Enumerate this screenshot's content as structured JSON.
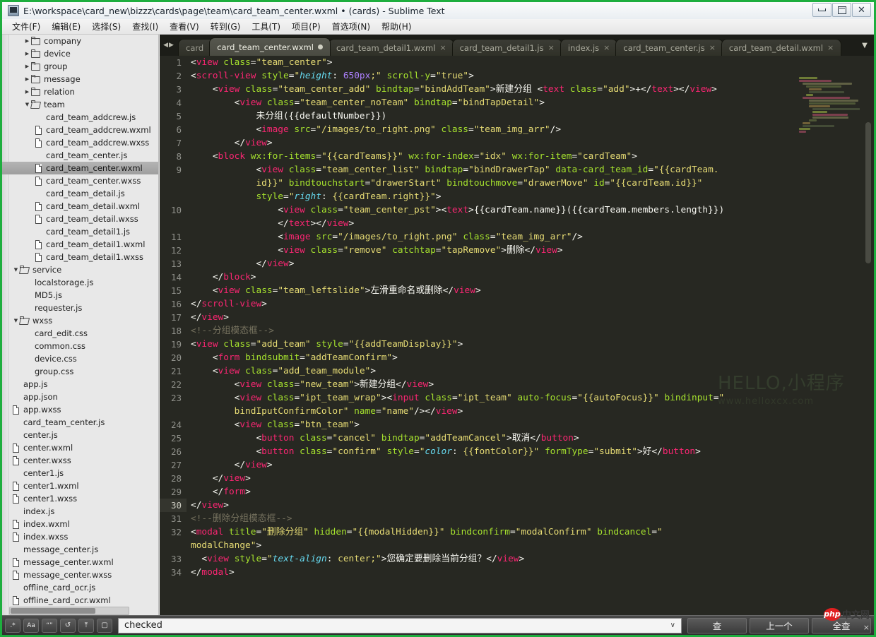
{
  "window": {
    "title": "E:\\workspace\\card_new\\bizzz\\cards\\page\\team\\card_team_center.wxml • (cards) - Sublime Text",
    "minimize_label": "—",
    "maximize_label": "□",
    "close_label": "✕",
    "accent_border": "#1eae3e"
  },
  "menu": [
    {
      "label": "文件(F)"
    },
    {
      "label": "编辑(E)"
    },
    {
      "label": "选择(S)"
    },
    {
      "label": "查找(I)"
    },
    {
      "label": "查看(V)"
    },
    {
      "label": "转到(G)"
    },
    {
      "label": "工具(T)"
    },
    {
      "label": "项目(P)"
    },
    {
      "label": "首选项(N)"
    },
    {
      "label": "帮助(H)"
    }
  ],
  "sidebar": {
    "items": [
      {
        "label": "company",
        "depth": 1,
        "kind": "folder",
        "open": false
      },
      {
        "label": "device",
        "depth": 1,
        "kind": "folder",
        "open": false
      },
      {
        "label": "group",
        "depth": 1,
        "kind": "folder",
        "open": false
      },
      {
        "label": "message",
        "depth": 1,
        "kind": "folder",
        "open": false
      },
      {
        "label": "relation",
        "depth": 1,
        "kind": "folder",
        "open": false
      },
      {
        "label": "team",
        "depth": 1,
        "kind": "folder",
        "open": true
      },
      {
        "label": "card_team_addcrew.js",
        "depth": 2,
        "kind": "plain"
      },
      {
        "label": "card_team_addcrew.wxml",
        "depth": 2,
        "kind": "file"
      },
      {
        "label": "card_team_addcrew.wxss",
        "depth": 2,
        "kind": "file"
      },
      {
        "label": "card_team_center.js",
        "depth": 2,
        "kind": "plain"
      },
      {
        "label": "card_team_center.wxml",
        "depth": 2,
        "kind": "file",
        "selected": true
      },
      {
        "label": "card_team_center.wxss",
        "depth": 2,
        "kind": "file"
      },
      {
        "label": "card_team_detail.js",
        "depth": 2,
        "kind": "plain"
      },
      {
        "label": "card_team_detail.wxml",
        "depth": 2,
        "kind": "file"
      },
      {
        "label": "card_team_detail.wxss",
        "depth": 2,
        "kind": "file"
      },
      {
        "label": "card_team_detail1.js",
        "depth": 2,
        "kind": "plain"
      },
      {
        "label": "card_team_detail1.wxml",
        "depth": 2,
        "kind": "file"
      },
      {
        "label": "card_team_detail1.wxss",
        "depth": 2,
        "kind": "file"
      },
      {
        "label": "service",
        "depth": 0,
        "kind": "folder",
        "open": true
      },
      {
        "label": "localstorage.js",
        "depth": 1,
        "kind": "plain"
      },
      {
        "label": "MD5.js",
        "depth": 1,
        "kind": "plain"
      },
      {
        "label": "requester.js",
        "depth": 1,
        "kind": "plain"
      },
      {
        "label": "wxss",
        "depth": 0,
        "kind": "folder",
        "open": true
      },
      {
        "label": "card_edit.css",
        "depth": 1,
        "kind": "plain"
      },
      {
        "label": "common.css",
        "depth": 1,
        "kind": "plain"
      },
      {
        "label": "device.css",
        "depth": 1,
        "kind": "plain"
      },
      {
        "label": "group.css",
        "depth": 1,
        "kind": "plain"
      },
      {
        "label": "app.js",
        "depth": 0,
        "kind": "plain"
      },
      {
        "label": "app.json",
        "depth": 0,
        "kind": "plain"
      },
      {
        "label": "app.wxss",
        "depth": 0,
        "kind": "file"
      },
      {
        "label": "card_team_center.js",
        "depth": 0,
        "kind": "plain"
      },
      {
        "label": "center.js",
        "depth": 0,
        "kind": "plain"
      },
      {
        "label": "center.wxml",
        "depth": 0,
        "kind": "file"
      },
      {
        "label": "center.wxss",
        "depth": 0,
        "kind": "file"
      },
      {
        "label": "center1.js",
        "depth": 0,
        "kind": "plain"
      },
      {
        "label": "center1.wxml",
        "depth": 0,
        "kind": "file"
      },
      {
        "label": "center1.wxss",
        "depth": 0,
        "kind": "file"
      },
      {
        "label": "index.js",
        "depth": 0,
        "kind": "plain"
      },
      {
        "label": "index.wxml",
        "depth": 0,
        "kind": "file"
      },
      {
        "label": "index.wxss",
        "depth": 0,
        "kind": "file"
      },
      {
        "label": "message_center.js",
        "depth": 0,
        "kind": "plain"
      },
      {
        "label": "message_center.wxml",
        "depth": 0,
        "kind": "file"
      },
      {
        "label": "message_center.wxss",
        "depth": 0,
        "kind": "file"
      },
      {
        "label": "offline_card_ocr.js",
        "depth": 0,
        "kind": "plain"
      },
      {
        "label": "offline_card_ocr.wxml",
        "depth": 0,
        "kind": "file"
      }
    ]
  },
  "tabs": {
    "nav_prev": "◀",
    "nav_next": "▶",
    "dropdown": "▼",
    "items": [
      {
        "label": "card",
        "active": false,
        "modified": false,
        "partial": true,
        "close": ""
      },
      {
        "label": "card_team_center.wxml",
        "active": true,
        "modified": true,
        "partial": false,
        "close": ""
      },
      {
        "label": "card_team_detail1.wxml",
        "active": false,
        "modified": false,
        "partial": false,
        "close": "×"
      },
      {
        "label": "card_team_detail1.js",
        "active": false,
        "modified": false,
        "partial": false,
        "close": "×"
      },
      {
        "label": "index.js",
        "active": false,
        "modified": false,
        "partial": false,
        "close": "×"
      },
      {
        "label": "card_team_center.js",
        "active": false,
        "modified": false,
        "partial": false,
        "close": "×"
      },
      {
        "label": "card_team_detail.wxml",
        "active": false,
        "modified": false,
        "partial": false,
        "close": "×"
      }
    ]
  },
  "editor": {
    "current_line": 30,
    "line_numbers": [
      1,
      2,
      3,
      4,
      5,
      6,
      7,
      8,
      9,
      null,
      null,
      10,
      null,
      11,
      12,
      13,
      14,
      15,
      16,
      17,
      18,
      19,
      20,
      21,
      22,
      23,
      null,
      24,
      25,
      26,
      27,
      28,
      29,
      30,
      31,
      32,
      null,
      33,
      34
    ],
    "lines": [
      {
        "n": 1,
        "html": "<span class='pun'>&lt;</span><span class='tagname'>view</span> <span class='attr'>class</span><span class='pun'>=</span><span class='str'>\"team_center\"</span><span class='pun'>&gt;</span>"
      },
      {
        "n": 2,
        "html": "<span class='pun'>&lt;</span><span class='tagname'>scroll-view</span> <span class='attr'>style</span><span class='pun'>=</span><span class='str'>\"</span><span class='prop'>height</span><span class='pun'>: </span><span class='num'>650px</span><span class='str'>;\"</span> <span class='attr'>scroll-y</span><span class='pun'>=</span><span class='str'>\"true\"</span><span class='pun'>&gt;</span>"
      },
      {
        "n": 3,
        "html": "    <span class='pun'>&lt;</span><span class='tagname'>view</span> <span class='attr'>class</span><span class='pun'>=</span><span class='str'>\"team_center_add\"</span> <span class='attr'>bindtap</span><span class='pun'>=</span><span class='str'>\"bindAddTeam\"</span><span class='pun'>&gt;</span><span class='txt'>新建分组 </span><span class='pun'>&lt;</span><span class='tagname'>text</span> <span class='attr'>class</span><span class='pun'>=</span><span class='str'>\"add\"</span><span class='pun'>&gt;+&lt;/</span><span class='tagname'>text</span><span class='pun'>&gt;&lt;/</span><span class='tagname'>view</span><span class='pun'>&gt;</span>"
      },
      {
        "n": 4,
        "html": "        <span class='pun'>&lt;</span><span class='tagname'>view</span> <span class='attr'>class</span><span class='pun'>=</span><span class='str'>\"team_center_noTeam\"</span> <span class='attr'>bindtap</span><span class='pun'>=</span><span class='str'>\"bindTapDetail\"</span><span class='pun'>&gt;</span>"
      },
      {
        "n": 5,
        "html": "            <span class='txt'>未分组({{defaultNumber}})</span>"
      },
      {
        "n": 6,
        "html": "            <span class='pun'>&lt;</span><span class='tagname'>image</span> <span class='attr'>src</span><span class='pun'>=</span><span class='str'>\"/images/to_right.png\"</span> <span class='attr'>class</span><span class='pun'>=</span><span class='str'>\"team_img_arr\"</span><span class='pun'>/&gt;</span>"
      },
      {
        "n": 7,
        "html": "        <span class='pun'>&lt;/</span><span class='tagname'>view</span><span class='pun'>&gt;</span>"
      },
      {
        "n": 8,
        "html": "    <span class='pun'>&lt;</span><span class='tagname'>block</span> <span class='attr'>wx:for-items</span><span class='pun'>=</span><span class='str'>\"{{cardTeams}}\"</span> <span class='attr'>wx:for-index</span><span class='pun'>=</span><span class='str'>\"idx\"</span> <span class='attr'>wx:for-item</span><span class='pun'>=</span><span class='str'>\"cardTeam\"</span><span class='pun'>&gt;</span>"
      },
      {
        "n": 9,
        "html": "            <span class='pun'>&lt;</span><span class='tagname'>view</span> <span class='attr'>class</span><span class='pun'>=</span><span class='str'>\"team_center_list\"</span> <span class='attr'>bindtap</span><span class='pun'>=</span><span class='str'>\"bindDrawerTap\"</span> <span class='attr'>data-card_team_id</span><span class='pun'>=</span><span class='str'>\"{{cardTeam.</span>"
      },
      {
        "n": null,
        "html": "            <span class='str'>id}}\"</span> <span class='attr'>bindtouchstart</span><span class='pun'>=</span><span class='str'>\"drawerStart\"</span> <span class='attr'>bindtouchmove</span><span class='pun'>=</span><span class='str'>\"drawerMove\"</span> <span class='attr'>id</span><span class='pun'>=</span><span class='str'>\"{{cardTeam.id}}\"</span>"
      },
      {
        "n": null,
        "html": "            <span class='attr'>style</span><span class='pun'>=</span><span class='str'>\"</span><span class='prop'>right</span><span class='pun'>: </span><span class='str'>{{cardTeam.right}}\"</span><span class='pun'>&gt;</span>"
      },
      {
        "n": 10,
        "html": "                <span class='pun'>&lt;</span><span class='tagname'>view</span> <span class='attr'>class</span><span class='pun'>=</span><span class='str'>\"team_center_pst\"</span><span class='pun'>&gt;&lt;</span><span class='tagname'>text</span><span class='pun'>&gt;</span><span class='txt'>{{cardTeam.name}}({{cardTeam.members.length}})</span>"
      },
      {
        "n": null,
        "html": "                <span class='pun'>&lt;/</span><span class='tagname'>text</span><span class='pun'>&gt;&lt;/</span><span class='tagname'>view</span><span class='pun'>&gt;</span>"
      },
      {
        "n": 11,
        "html": "                <span class='pun'>&lt;</span><span class='tagname'>image</span> <span class='attr'>src</span><span class='pun'>=</span><span class='str'>\"/images/to_right.png\"</span> <span class='attr'>class</span><span class='pun'>=</span><span class='str'>\"team_img_arr\"</span><span class='pun'>/&gt;</span>"
      },
      {
        "n": 12,
        "html": "                <span class='pun'>&lt;</span><span class='tagname'>view</span> <span class='attr'>class</span><span class='pun'>=</span><span class='str'>\"remove\"</span> <span class='attr'>catchtap</span><span class='pun'>=</span><span class='str'>\"tapRemove\"</span><span class='pun'>&gt;</span><span class='txt'>删除</span><span class='pun'>&lt;/</span><span class='tagname'>view</span><span class='pun'>&gt;</span>"
      },
      {
        "n": 13,
        "html": "            <span class='pun'>&lt;/</span><span class='tagname'>view</span><span class='pun'>&gt;</span>"
      },
      {
        "n": 14,
        "html": "    <span class='pun'>&lt;/</span><span class='tagname'>block</span><span class='pun'>&gt;</span>"
      },
      {
        "n": 15,
        "html": "    <span class='pun'>&lt;</span><span class='tagname'>view</span> <span class='attr'>class</span><span class='pun'>=</span><span class='str'>\"team_leftslide\"</span><span class='pun'>&gt;</span><span class='txt'>左滑重命名或删除</span><span class='pun'>&lt;/</span><span class='tagname'>view</span><span class='pun'>&gt;</span>"
      },
      {
        "n": 16,
        "html": "<span class='pun'>&lt;/</span><span class='tagname'>scroll-view</span><span class='pun'>&gt;</span>"
      },
      {
        "n": 17,
        "html": "<span class='pun'>&lt;/</span><span class='tagname'>view</span><span class='pun'>&gt;</span>"
      },
      {
        "n": 18,
        "html": "<span class='com'>&lt;!--分组模态框--&gt;</span>"
      },
      {
        "n": 19,
        "html": "<span class='pun'>&lt;</span><span class='tagname'>view</span> <span class='attr'>class</span><span class='pun'>=</span><span class='str'>\"add_team\"</span> <span class='attr'>style</span><span class='pun'>=</span><span class='str'>\"{{addTeamDisplay}}\"</span><span class='pun'>&gt;</span>"
      },
      {
        "n": 20,
        "html": "    <span class='pun'>&lt;</span><span class='tagname'>form</span> <span class='attr'>bindsubmit</span><span class='pun'>=</span><span class='str'>\"addTeamConfirm\"</span><span class='pun'>&gt;</span>"
      },
      {
        "n": 21,
        "html": "    <span class='pun'>&lt;</span><span class='tagname'>view</span> <span class='attr'>class</span><span class='pun'>=</span><span class='str'>\"add_team_module\"</span><span class='pun'>&gt;</span>"
      },
      {
        "n": 22,
        "html": "        <span class='pun'>&lt;</span><span class='tagname'>view</span> <span class='attr'>class</span><span class='pun'>=</span><span class='str'>\"new_team\"</span><span class='pun'>&gt;</span><span class='txt'>新建分组</span><span class='pun'>&lt;/</span><span class='tagname'>view</span><span class='pun'>&gt;</span>"
      },
      {
        "n": 23,
        "html": "        <span class='pun'>&lt;</span><span class='tagname'>view</span> <span class='attr'>class</span><span class='pun'>=</span><span class='str'>\"ipt_team_wrap\"</span><span class='pun'>&gt;&lt;</span><span class='tagname'>input</span> <span class='attr'>class</span><span class='pun'>=</span><span class='str'>\"ipt_team\"</span> <span class='attr'>auto-focus</span><span class='pun'>=</span><span class='str'>\"{{autoFocus}}\"</span> <span class='attr'>bindinput</span><span class='pun'>=</span><span class='str'>\"</span>"
      },
      {
        "n": null,
        "html": "        <span class='str'>bindIputConfirmColor\"</span> <span class='attr'>name</span><span class='pun'>=</span><span class='str'>\"name\"</span><span class='pun'>/&gt;&lt;/</span><span class='tagname'>view</span><span class='pun'>&gt;</span>"
      },
      {
        "n": 24,
        "html": "        <span class='pun'>&lt;</span><span class='tagname'>view</span> <span class='attr'>class</span><span class='pun'>=</span><span class='str'>\"btn_team\"</span><span class='pun'>&gt;</span>"
      },
      {
        "n": 25,
        "html": "            <span class='pun'>&lt;</span><span class='tagname'>button</span> <span class='attr'>class</span><span class='pun'>=</span><span class='str'>\"cancel\"</span> <span class='attr'>bindtap</span><span class='pun'>=</span><span class='str'>\"addTeamCancel\"</span><span class='pun'>&gt;</span><span class='txt'>取消</span><span class='pun'>&lt;/</span><span class='tagname'>button</span><span class='pun'>&gt;</span>"
      },
      {
        "n": 26,
        "html": "            <span class='pun'>&lt;</span><span class='tagname'>button</span> <span class='attr'>class</span><span class='pun'>=</span><span class='str'>\"confirm\"</span> <span class='attr'>style</span><span class='pun'>=</span><span class='str'>\"</span><span class='prop'>color</span><span class='pun'>: </span><span class='str'>{{fontColor}}\"</span> <span class='attr'>formType</span><span class='pun'>=</span><span class='str'>\"submit\"</span><span class='pun'>&gt;</span><span class='txt'>好</span><span class='pun'>&lt;/</span><span class='tagname'>button</span><span class='pun'>&gt;</span>"
      },
      {
        "n": 27,
        "html": "        <span class='pun'>&lt;/</span><span class='tagname'>view</span><span class='pun'>&gt;</span>"
      },
      {
        "n": 28,
        "html": "    <span class='pun'>&lt;/</span><span class='tagname'>view</span><span class='pun'>&gt;</span>"
      },
      {
        "n": 29,
        "html": "    <span class='pun'>&lt;/</span><span class='tagname'>form</span><span class='pun'>&gt;</span>"
      },
      {
        "n": 30,
        "html": "<span class='pun'>&lt;/</span><span class='tagname'>view</span><span class='pun'>&gt;</span>"
      },
      {
        "n": 31,
        "html": "<span class='com'>&lt;!--删除分组模态框--&gt;</span>"
      },
      {
        "n": 32,
        "html": "<span class='pun'>&lt;</span><span class='tagname'>modal</span> <span class='attr'>title</span><span class='pun'>=</span><span class='str'>\"删除分组\"</span> <span class='attr'>hidden</span><span class='pun'>=</span><span class='str'>\"{{modalHidden}}\"</span> <span class='attr'>bindconfirm</span><span class='pun'>=</span><span class='str'>\"modalConfirm\"</span> <span class='attr'>bindcancel</span><span class='pun'>=</span><span class='str'>\"</span>"
      },
      {
        "n": null,
        "html": "<span class='str'>modalChange\"</span><span class='pun'>&gt;</span>"
      },
      {
        "n": 33,
        "html": "  <span class='pun'>&lt;</span><span class='tagname'>view</span> <span class='attr'>style</span><span class='pun'>=</span><span class='str'>\"</span><span class='prop'>text-align</span><span class='pun'>: </span><span class='str'>center;\"</span><span class='pun'>&gt;</span><span class='txt'>您确定要删除当前分组？</span><span class='pun'>&lt;/</span><span class='tagname'>view</span><span class='pun'>&gt;</span>"
      },
      {
        "n": 34,
        "html": "<span class='pun'>&lt;/</span><span class='tagname'>modal</span><span class='pun'>&gt;</span>"
      }
    ],
    "watermark_main": "HELLO,小程序",
    "watermark_sub": "www.helloxcx.com",
    "background": "#272822"
  },
  "findbar": {
    "toggles": [
      {
        "label": ".*",
        "name": "regex"
      },
      {
        "label": "Aa",
        "name": "case-sensitive"
      },
      {
        "label": "“”",
        "name": "whole-word"
      },
      {
        "label": "↺",
        "name": "wrap"
      },
      {
        "label": "⤒",
        "name": "in-selection"
      },
      {
        "label": "▢",
        "name": "highlight"
      }
    ],
    "search_value": "checked",
    "dropdown_icon": "∨",
    "buttons": [
      {
        "label": "查"
      },
      {
        "label": "上一个"
      },
      {
        "label": "全查"
      }
    ],
    "close_label": "×"
  },
  "badge": {
    "logo": "php",
    "text": "中文网"
  }
}
